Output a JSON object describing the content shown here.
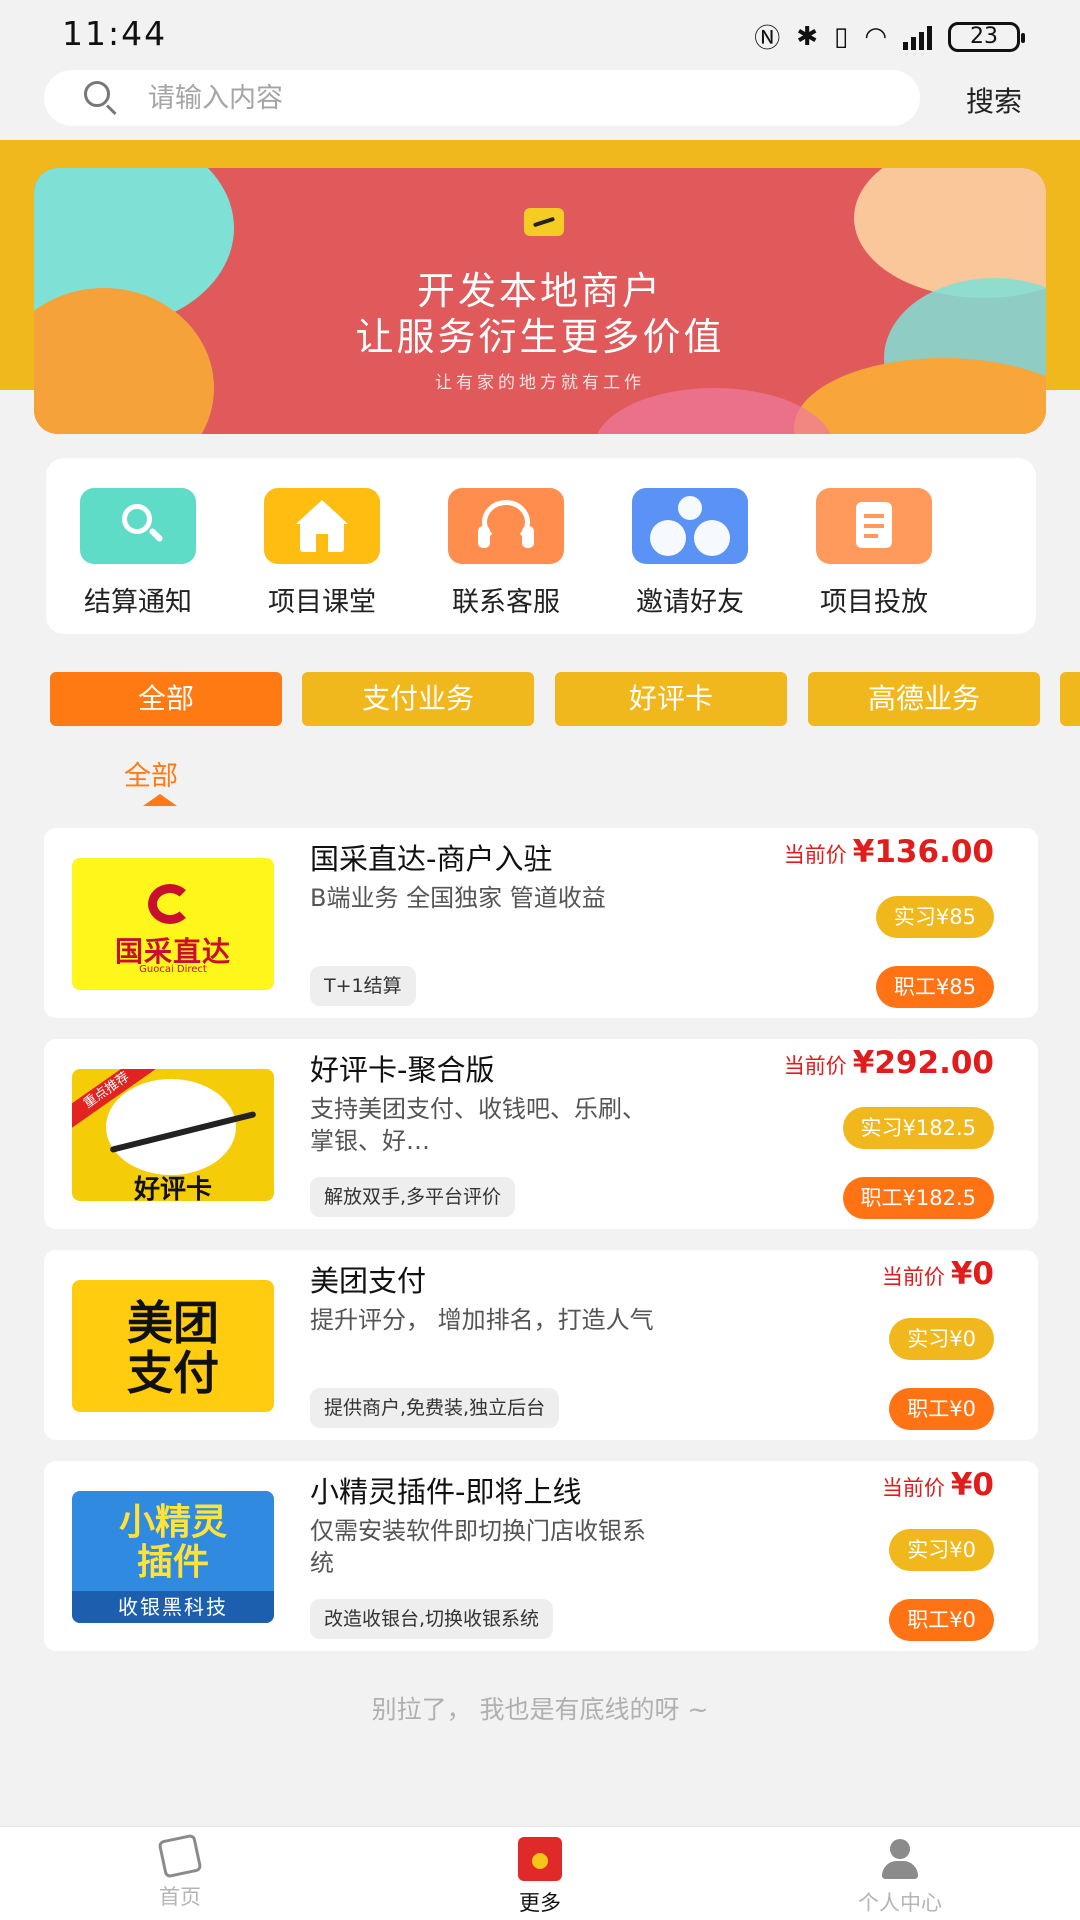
{
  "status_bar": {
    "time": "11:44",
    "icons": [
      "nfc-icon",
      "bluetooth-icon",
      "vibrate-icon",
      "wifi-6-icon",
      "signal-icon"
    ],
    "battery": "23"
  },
  "search": {
    "placeholder": "请输入内容",
    "button_label": "搜索"
  },
  "banner": {
    "line1": "开发本地商户",
    "line2": "让服务衍生更多价值",
    "subtitle": "让有家的地方就有工作"
  },
  "quick_menu": [
    {
      "label": "结算通知",
      "icon": "search-icon",
      "color": "#5edcc8"
    },
    {
      "label": "项目课堂",
      "icon": "home-icon",
      "color": "#ffbd12"
    },
    {
      "label": "联系客服",
      "icon": "headset-icon",
      "color": "#ff8d4e"
    },
    {
      "label": "邀请好友",
      "icon": "people-icon",
      "color": "#5a93f5"
    },
    {
      "label": "项目投放",
      "icon": "document-icon",
      "color": "#ff9a5c"
    }
  ],
  "tabs": [
    {
      "label": "全部",
      "active": true
    },
    {
      "label": "支付业务",
      "active": false
    },
    {
      "label": "好评卡",
      "active": false
    },
    {
      "label": "高德业务",
      "active": false
    }
  ],
  "current_tab": "全部",
  "products": [
    {
      "title": "国采直达-商户入驻",
      "desc": "B端业务 全国独家 管道收益",
      "tag": "T+1结算",
      "price_label": "当前价",
      "price": "¥136.00",
      "intern": "实习¥85",
      "staff": "职工¥85",
      "thumb_text": "国采直达",
      "thumb_sub": "Guocai Direct"
    },
    {
      "title": "好评卡-聚合版",
      "desc": "支持美团支付、收钱吧、乐刷、掌银、好…",
      "tag": "解放双手,多平台评价",
      "price_label": "当前价",
      "price": "¥292.00",
      "intern": "实习¥182.5",
      "staff": "职工¥182.5",
      "thumb_text": "好评卡",
      "thumb_ribbon": "重点推荐"
    },
    {
      "title": "美团支付",
      "desc": "提升评分， 增加排名，打造人气",
      "tag": "提供商户,免费装,独立后台",
      "price_label": "当前价",
      "price": "¥0",
      "intern": "实习¥0",
      "staff": "职工¥0",
      "thumb_text": "美团支付"
    },
    {
      "title": "小精灵插件-即将上线",
      "desc": "仅需安装软件即切换门店收银系统",
      "tag": "改造收银台,切换收银系统",
      "price_label": "当前价",
      "price": "¥0",
      "intern": "实习¥0",
      "staff": "职工¥0",
      "thumb_text": "小精灵插件",
      "thumb_sub": "收银黑科技"
    }
  ],
  "footer_note": "别拉了， 我也是有底线的呀 ~",
  "bottom_nav": [
    {
      "label": "首页",
      "icon": "home-icon",
      "active": false
    },
    {
      "label": "更多",
      "icon": "red-packet-icon",
      "active": true
    },
    {
      "label": "个人中心",
      "icon": "user-icon",
      "active": false
    }
  ],
  "colors": {
    "accent_orange": "#ff7a12",
    "accent_yellow": "#f0b81c",
    "price_red": "#e01c1c"
  }
}
